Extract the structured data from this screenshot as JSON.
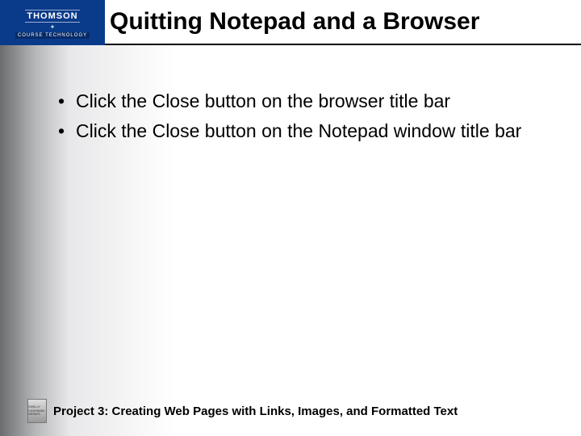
{
  "logo": {
    "brand": "THOMSON",
    "sub": "COURSE TECHNOLOGY"
  },
  "title": "Quitting Notepad and a Browser",
  "bullets": [
    "Click the Close button on the browser title bar",
    "Click the Close button on the Notepad window title bar"
  ],
  "footer": {
    "series": "SHELLY CASHMAN SERIES",
    "text": "Project 3: Creating Web Pages with Links, Images, and Formatted Text"
  }
}
